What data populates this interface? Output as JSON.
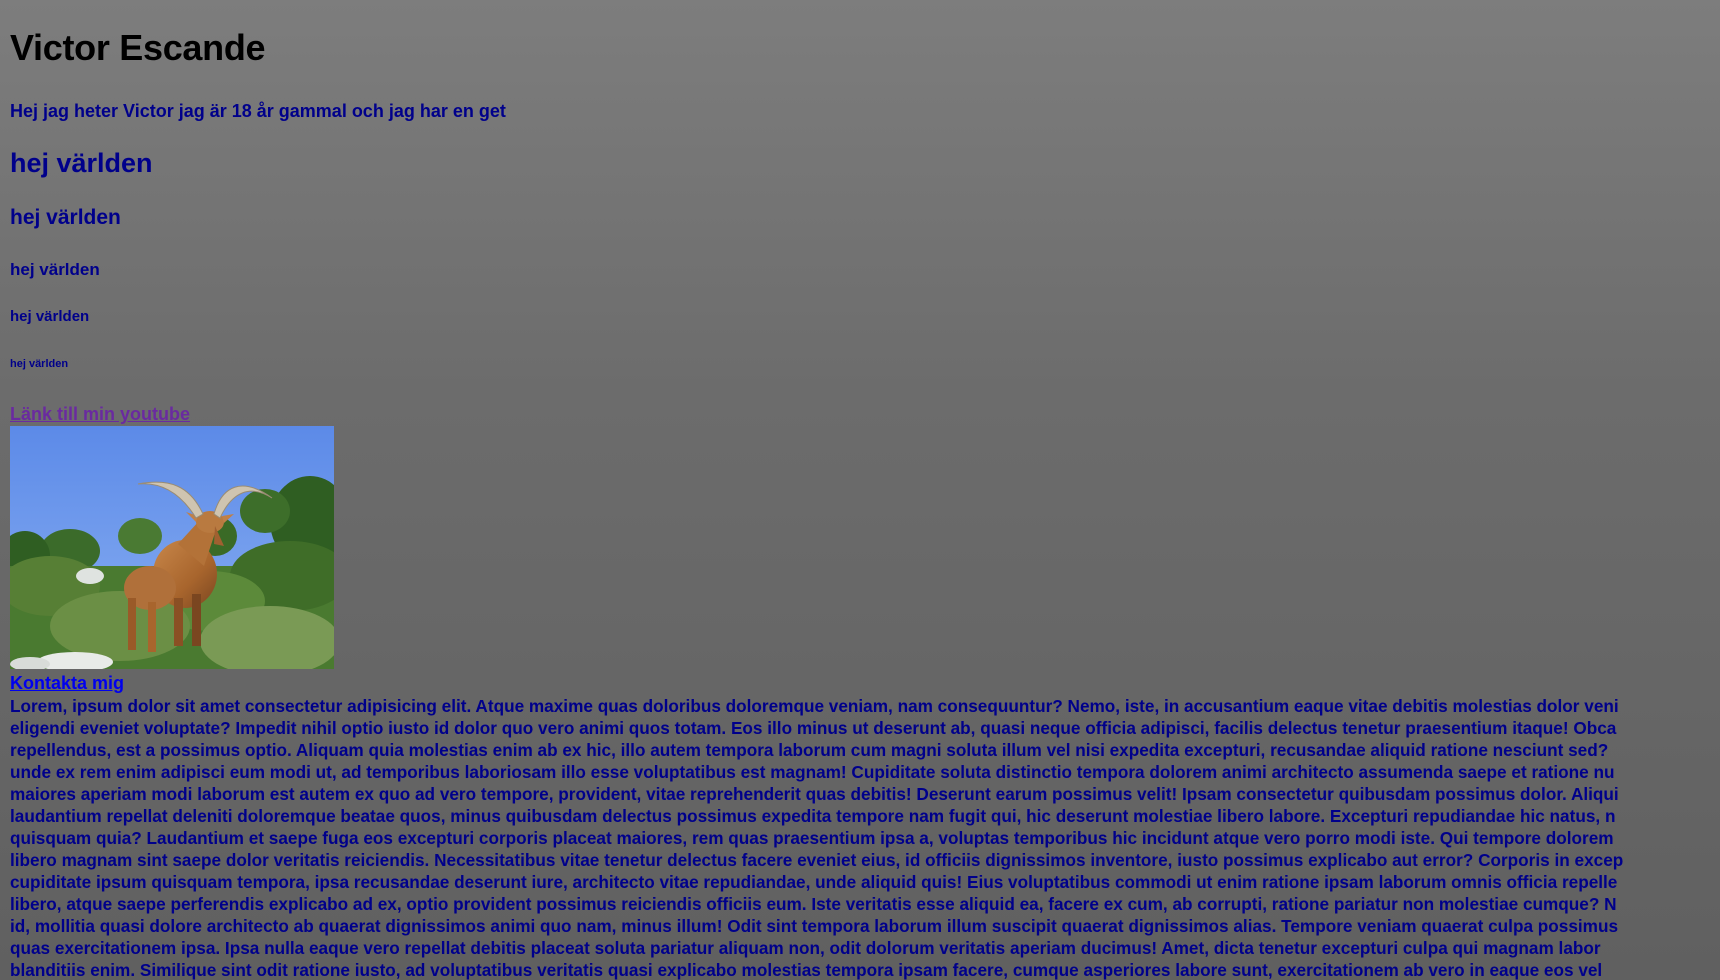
{
  "page": {
    "title": "Victor Escande",
    "intro": "Hej jag heter Victor jag är 18 år gammal och jag har en get",
    "headings": [
      "hej världen",
      "hej världen",
      "hej världen",
      "hej världen",
      "hej världen"
    ],
    "youtube_link": "Länk till min youtube",
    "contact_link": "Kontakta mig",
    "lorem_lines": [
      "Lorem, ipsum dolor sit amet consectetur adipisicing elit. Atque maxime quas doloribus doloremque veniam, nam consequuntur? Nemo, iste, in accusantium eaque vitae debitis molestias dolor veni",
      "eligendi eveniet voluptate? Impedit nihil optio iusto id dolor quo vero animi quos totam. Eos illo minus ut deserunt ab, quasi neque officia adipisci, facilis delectus tenetur praesentium itaque! Obca",
      "repellendus, est a possimus optio. Aliquam quia molestias enim ab ex hic, illo autem tempora laborum cum magni soluta illum vel nisi expedita excepturi, recusandae aliquid ratione nesciunt sed?",
      "unde ex rem enim adipisci eum modi ut, ad temporibus laboriosam illo esse voluptatibus est magnam! Cupiditate soluta distinctio tempora dolorem animi architecto assumenda saepe et ratione nu",
      "maiores aperiam modi laborum est autem ex quo ad vero tempore, provident, vitae reprehenderit quas debitis! Deserunt earum possimus velit! Ipsam consectetur quibusdam possimus dolor. Aliqui",
      "laudantium repellat deleniti doloremque beatae quos, minus quibusdam delectus possimus expedita tempore nam fugit qui, hic deserunt molestiae libero labore. Excepturi repudiandae hic natus, n",
      "quisquam quia? Laudantium et saepe fuga eos excepturi corporis placeat maiores, rem quas praesentium ipsa a, voluptas temporibus hic incidunt atque vero porro modi iste. Qui tempore dolorem",
      "libero magnam sint saepe dolor veritatis reiciendis. Necessitatibus vitae tenetur delectus facere eveniet eius, id officiis dignissimos inventore, iusto possimus explicabo aut error? Corporis in excep",
      "cupiditate ipsum quisquam tempora, ipsa recusandae deserunt iure, architecto vitae repudiandae, unde aliquid quis! Eius voluptatibus commodi ut enim ratione ipsam laborum omnis officia repelle",
      "libero, atque saepe perferendis explicabo ad ex, optio provident possimus reiciendis officiis eum. Iste veritatis esse aliquid ea, facere ex cum, ab corrupti, ratione pariatur non molestiae cumque? N",
      "id, mollitia quasi dolore architecto ab quaerat dignissimos animi quo nam, minus illum! Odit sint tempora laborum illum suscipit quaerat dignissimos alias. Tempore veniam quaerat culpa possimus",
      "quas exercitationem ipsa. Ipsa nulla eaque vero repellat debitis placeat soluta pariatur aliquam non, odit dolorum veritatis aperiam ducimus! Amet, dicta tenetur excepturi culpa qui magnam labor",
      "blanditiis enim. Similique sint odit ratione iusto, ad voluptatibus veritatis quasi explicabo molestias tempora ipsam facere, cumque asperiores labore sunt, exercitationem ab vero in eaque eos vel"
    ]
  },
  "colors": {
    "background_top": "#7d7d7d",
    "background_bottom": "#606060",
    "title": "#000000",
    "body_text": "#00008b",
    "visited_link": "#6a2aa0",
    "link": "#0000ee"
  },
  "image": {
    "subject": "goat-photo"
  }
}
